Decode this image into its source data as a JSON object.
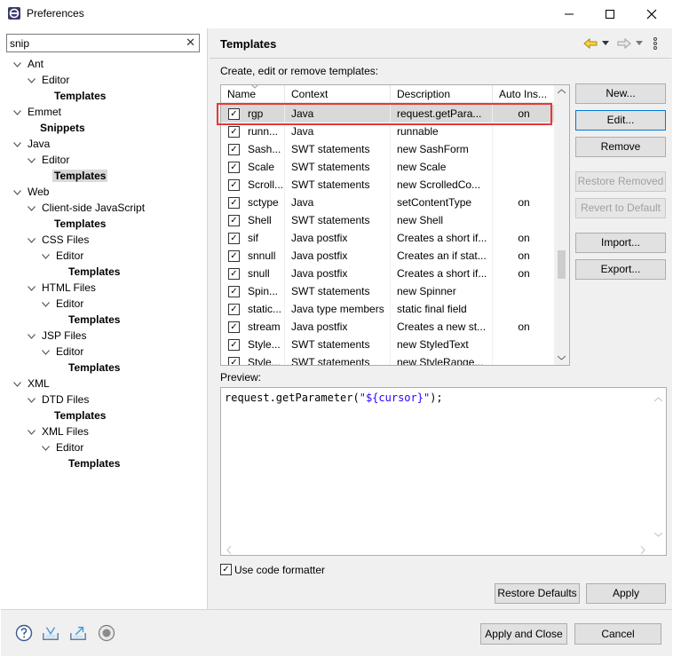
{
  "window": {
    "title": "Preferences"
  },
  "filter": {
    "value": "snip"
  },
  "tree": [
    {
      "label": "Ant",
      "level": 0,
      "chevron": "expanded",
      "bold": false,
      "selected": false
    },
    {
      "label": "Editor",
      "level": 1,
      "chevron": "expanded",
      "bold": false,
      "selected": false
    },
    {
      "label": "Templates",
      "level": 2,
      "chevron": "",
      "bold": true,
      "selected": false
    },
    {
      "label": "Emmet",
      "level": 0,
      "chevron": "expanded",
      "bold": false,
      "selected": false
    },
    {
      "label": "Snippets",
      "level": 1,
      "chevron": "",
      "bold": true,
      "selected": false
    },
    {
      "label": "Java",
      "level": 0,
      "chevron": "expanded",
      "bold": false,
      "selected": false
    },
    {
      "label": "Editor",
      "level": 1,
      "chevron": "expanded",
      "bold": false,
      "selected": false
    },
    {
      "label": "Templates",
      "level": 2,
      "chevron": "",
      "bold": true,
      "selected": true
    },
    {
      "label": "Web",
      "level": 0,
      "chevron": "expanded",
      "bold": false,
      "selected": false
    },
    {
      "label": "Client-side JavaScript",
      "level": 1,
      "chevron": "expanded",
      "bold": false,
      "selected": false
    },
    {
      "label": "Templates",
      "level": 2,
      "chevron": "",
      "bold": true,
      "selected": false
    },
    {
      "label": "CSS Files",
      "level": 1,
      "chevron": "expanded",
      "bold": false,
      "selected": false
    },
    {
      "label": "Editor",
      "level": 2,
      "chevron": "expanded",
      "bold": false,
      "selected": false
    },
    {
      "label": "Templates",
      "level": 3,
      "chevron": "",
      "bold": true,
      "selected": false
    },
    {
      "label": "HTML Files",
      "level": 1,
      "chevron": "expanded",
      "bold": false,
      "selected": false
    },
    {
      "label": "Editor",
      "level": 2,
      "chevron": "expanded",
      "bold": false,
      "selected": false
    },
    {
      "label": "Templates",
      "level": 3,
      "chevron": "",
      "bold": true,
      "selected": false
    },
    {
      "label": "JSP Files",
      "level": 1,
      "chevron": "expanded",
      "bold": false,
      "selected": false
    },
    {
      "label": "Editor",
      "level": 2,
      "chevron": "expanded",
      "bold": false,
      "selected": false
    },
    {
      "label": "Templates",
      "level": 3,
      "chevron": "",
      "bold": true,
      "selected": false
    },
    {
      "label": "XML",
      "level": 0,
      "chevron": "expanded",
      "bold": false,
      "selected": false
    },
    {
      "label": "DTD Files",
      "level": 1,
      "chevron": "expanded",
      "bold": false,
      "selected": false
    },
    {
      "label": "Templates",
      "level": 2,
      "chevron": "",
      "bold": true,
      "selected": false
    },
    {
      "label": "XML Files",
      "level": 1,
      "chevron": "expanded",
      "bold": false,
      "selected": false
    },
    {
      "label": "Editor",
      "level": 2,
      "chevron": "expanded",
      "bold": false,
      "selected": false
    },
    {
      "label": "Templates",
      "level": 3,
      "chevron": "",
      "bold": true,
      "selected": false
    }
  ],
  "page": {
    "title": "Templates",
    "caption": "Create, edit or remove templates:",
    "nav_icons": [
      "back-arrow-icon",
      "back-menu-icon",
      "forward-arrow-icon",
      "forward-menu-icon",
      "view-menu-icon"
    ]
  },
  "table": {
    "columns": [
      "Name",
      "Context",
      "Description",
      "Auto Ins..."
    ],
    "rows": [
      {
        "checked": true,
        "name": "rgp",
        "context": "Java",
        "description": "request.getPara...",
        "auto": "on",
        "selected": true
      },
      {
        "checked": true,
        "name": "runn...",
        "context": "Java",
        "description": "runnable",
        "auto": ""
      },
      {
        "checked": true,
        "name": "Sash...",
        "context": "SWT statements",
        "description": "new SashForm",
        "auto": ""
      },
      {
        "checked": true,
        "name": "Scale",
        "context": "SWT statements",
        "description": "new Scale",
        "auto": ""
      },
      {
        "checked": true,
        "name": "Scroll...",
        "context": "SWT statements",
        "description": "new ScrolledCo...",
        "auto": ""
      },
      {
        "checked": true,
        "name": "sctype",
        "context": "Java",
        "description": "setContentType",
        "auto": "on"
      },
      {
        "checked": true,
        "name": "Shell",
        "context": "SWT statements",
        "description": "new Shell",
        "auto": ""
      },
      {
        "checked": true,
        "name": "sif",
        "context": "Java postfix",
        "description": "Creates a short if...",
        "auto": "on"
      },
      {
        "checked": true,
        "name": "snnull",
        "context": "Java postfix",
        "description": "Creates an if stat...",
        "auto": "on"
      },
      {
        "checked": true,
        "name": "snull",
        "context": "Java postfix",
        "description": "Creates a short if...",
        "auto": "on"
      },
      {
        "checked": true,
        "name": "Spin...",
        "context": "SWT statements",
        "description": "new Spinner",
        "auto": ""
      },
      {
        "checked": true,
        "name": "static...",
        "context": "Java type members",
        "description": "static final field",
        "auto": ""
      },
      {
        "checked": true,
        "name": "stream",
        "context": "Java postfix",
        "description": "Creates a new st...",
        "auto": "on"
      },
      {
        "checked": true,
        "name": "Style...",
        "context": "SWT statements",
        "description": "new StyledText",
        "auto": ""
      },
      {
        "checked": true,
        "name": "Style...",
        "context": "SWT statements",
        "description": "new StyleRange...",
        "auto": ""
      }
    ]
  },
  "buttons": {
    "new": "New...",
    "edit": "Edit...",
    "remove": "Remove",
    "restore_removed": "Restore Removed",
    "revert_default": "Revert to Default",
    "import": "Import...",
    "export": "Export...",
    "restore_defaults": "Restore Defaults",
    "apply": "Apply",
    "apply_close": "Apply and Close",
    "cancel": "Cancel"
  },
  "preview": {
    "label": "Preview:",
    "code_prefix": "request.getParameter(",
    "code_string": "\"${cursor}\"",
    "code_suffix": ");"
  },
  "formatter": {
    "label": "Use code formatter",
    "checked": true
  },
  "footer_icons": [
    "help-icon",
    "import-prefs-icon",
    "export-prefs-icon",
    "oomph-record-icon"
  ],
  "colors": {
    "highlight": "#e53935",
    "focus": "#0078d7",
    "string": "#2a00ff"
  }
}
